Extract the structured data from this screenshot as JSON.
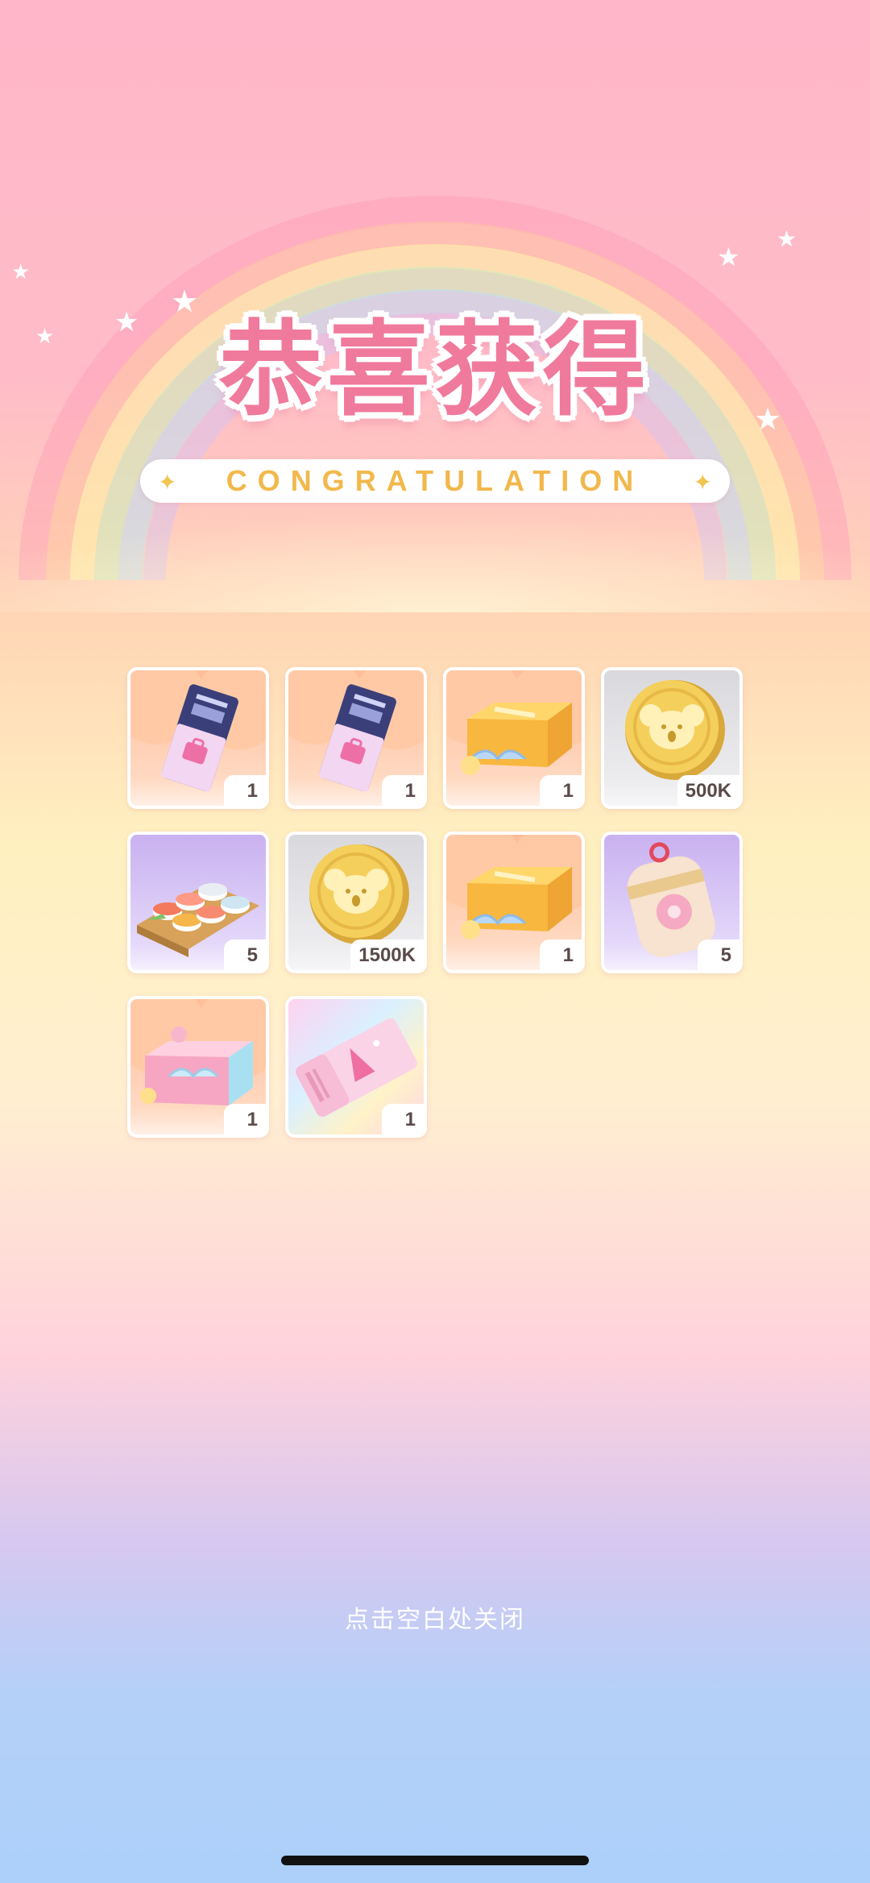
{
  "header": {
    "title": "恭喜获得",
    "subtitle": "CONGRATULATION"
  },
  "rewards": [
    {
      "item": "ticket-icon",
      "count": "1"
    },
    {
      "item": "ticket-icon",
      "count": "1"
    },
    {
      "item": "gift-box-icon",
      "count": "1"
    },
    {
      "item": "koala-coin-icon",
      "count": "500K"
    },
    {
      "item": "sushi-platter-icon",
      "count": "5"
    },
    {
      "item": "koala-coin-icon",
      "count": "1500K"
    },
    {
      "item": "gift-box-icon",
      "count": "1"
    },
    {
      "item": "charm-icon",
      "count": "5"
    },
    {
      "item": "pink-box-icon",
      "count": "1"
    },
    {
      "item": "coupon-icon",
      "count": "1"
    }
  ],
  "footer": {
    "close_hint": "点击空白处关闭"
  },
  "colors": {
    "title": "#f07a9c",
    "subtitle": "#f2b84c",
    "count_text": "#5a4a4a"
  }
}
